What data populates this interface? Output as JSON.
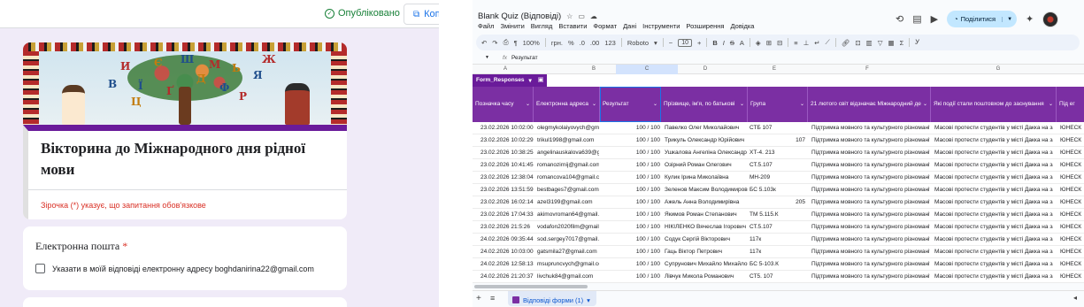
{
  "form": {
    "published_label": "Опубліковано",
    "copy_label": "Коп",
    "title": "Вікторина до Міжнародного дня рідної мови",
    "required_note": "Зірочка (*) указує, що запитання обов'язкове",
    "email_question": "Електронна пошта",
    "required_mark": "*",
    "email_checkbox_label": "Указати в моїй відповіді електронну адресу boghdanirina22@gmail.com",
    "banner_letters": [
      "И",
      "Ї",
      "Є",
      "Ґ",
      "Ш",
      "Д",
      "М",
      "Ф",
      "Ь",
      "Ц",
      "Р",
      "В",
      "Я",
      "Ж"
    ]
  },
  "sheet": {
    "doc_title": "Blank Quiz (Відповіді)",
    "menu": [
      "Файл",
      "Змінити",
      "Вигляд",
      "Вставити",
      "Формат",
      "Дані",
      "Інструменти",
      "Розширення",
      "Довідка"
    ],
    "share_label": "Поділитися",
    "toolbar": {
      "zoom": "100%",
      "currency": "грн.",
      "percent": "%",
      "dec_less": ".0",
      "dec_more": ".00",
      "num_format": "123",
      "font": "Roboto",
      "font_size": "10"
    },
    "name_box": "",
    "formula_value": "Результат",
    "column_letters": [
      "A",
      "B",
      "C",
      "D",
      "E",
      "F",
      "G"
    ],
    "table_name": "Form_Responses",
    "headers": [
      "Позначка часу",
      "Електронна адреса",
      "Результат",
      "Прізвище, ім'я, по батькові",
      "Група",
      "21 лютого світ відзначає Міжнародний де",
      "Які події стали поштовхом до заснування",
      "Під ег"
    ],
    "rows": [
      [
        "23.02.2026 10:02:00",
        "olegmykolaiyovych@gmail",
        "100 / 100",
        "Павелко Олег Миколайович",
        "СТБ 107",
        "",
        "Підтримка мовного та культурного різноманіт",
        "Масові протести студентів у місті Дакка на зах",
        "ЮНЕСК"
      ],
      [
        "23.02.2026 10:02:29",
        "trikul1998@gmail.com",
        "100 / 100",
        "Трикуль Олександр Юрійович",
        "",
        "107",
        "Підтримка мовного та культурного різноманіт",
        "Масові протести студентів у місті Дакка на зах",
        "ЮНЕСК"
      ],
      [
        "23.02.2026 10:38:25",
        "angelinauskalova639@gn",
        "100 / 100",
        "Ушкалова Ангеліна Олександр",
        "ХТ-4. 213",
        "",
        "Підтримка мовного та культурного різноманіт",
        "Масові протести студентів у місті Дакка на зах",
        "ЮНЕСК"
      ],
      [
        "23.02.2026 10:41:45",
        "romanozirnij@gmail.com",
        "100 / 100",
        "Озірний Роман Олегович",
        "СТ.5.107",
        "",
        "Підтримка мовного та культурного різноманіт",
        "Масові протести студентів у місті Дакка на зах",
        "ЮНЕСК"
      ],
      [
        "23.02.2026 12:38:04",
        "romancova104@gmail.com",
        "100 / 100",
        "Кулик Ірина Миколаївна",
        "МН-209",
        "",
        "Підтримка мовного та культурного різноманіт",
        "Масові протести студентів у місті Дакка на зах",
        "ЮНЕСК"
      ],
      [
        "23.02.2026 13:51:59",
        "bestbages7@gmail.com",
        "100 / 100",
        "Зеленов Максим Володимиров",
        "БС 5.103к",
        "",
        "Підтримка мовного та культурного різноманіт",
        "Масові протести студентів у місті Дакка на зах",
        "ЮНЕСК"
      ],
      [
        "23.02.2026 16:02:14",
        "azel3199@gmail.com",
        "100 / 100",
        "Ажель Анна Володимирівна",
        "",
        "205",
        "Підтримка мовного та культурного різноманіт",
        "Масові протести студентів у місті Дакка на зах",
        "ЮНЕСК"
      ],
      [
        "23.02.2026 17:04:33",
        "akimovroman64@gmail.cc",
        "100 / 100",
        "Якимов Роман Степанович",
        "ТМ 5.115.К",
        "",
        "Підтримка мовного та культурного різноманіт",
        "Масові протести студентів у місті Дакка на зах",
        "ЮНЕСК"
      ],
      [
        "23.02.2026 21:5:26",
        "vodafon2020film@gmail.c",
        "100 / 100",
        "НІКІЛЕНКО Вячеслав Ігорович",
        "СТ.5.107",
        "",
        "Підтримка мовного та культурного різноманіт",
        "Масові протести студентів у місті Дакка на зах",
        "ЮНЕСК"
      ],
      [
        "24.02.2026 09:35:44",
        "sod.sergey7017@gmail.cc",
        "100 / 100",
        "Содук Сергій Вікторович",
        "117к",
        "",
        "Підтримка мовного та культурного різноманіт",
        "Масові протести студентів у місті Дакка на зах",
        "ЮНЕСК"
      ],
      [
        "24.02.2026 10:03:00",
        "gatsmila27@gmail.com",
        "100 / 100",
        "Гаць Віктор Петрович",
        "117к",
        "",
        "Підтримка мовного та культурного різноманіт",
        "Масові протести студентів у місті Дакка на зах",
        "ЮНЕСК"
      ],
      [
        "24.02.2026 12:58:13",
        "msupruncvych@gmail.com",
        "100 / 100",
        "Супрунович Михайло Михайлов",
        "БС 5-103.К",
        "",
        "Підтримка мовного та культурного різноманіт",
        "Масові протести студентів у місті Дакка на зах",
        "ЮНЕСК"
      ],
      [
        "24.02.2026 21:20:37",
        "livchuk84@gmail.com",
        "100 / 100",
        "Лівчук Микола Романович",
        "СТ5. 107",
        "",
        "Підтримка мовного та культурного різноманіт",
        "Масові протести студентів у місті Дакка на зах",
        "ЮНЕСК"
      ]
    ],
    "sheet_tab": "Відповіді форми (1)"
  }
}
